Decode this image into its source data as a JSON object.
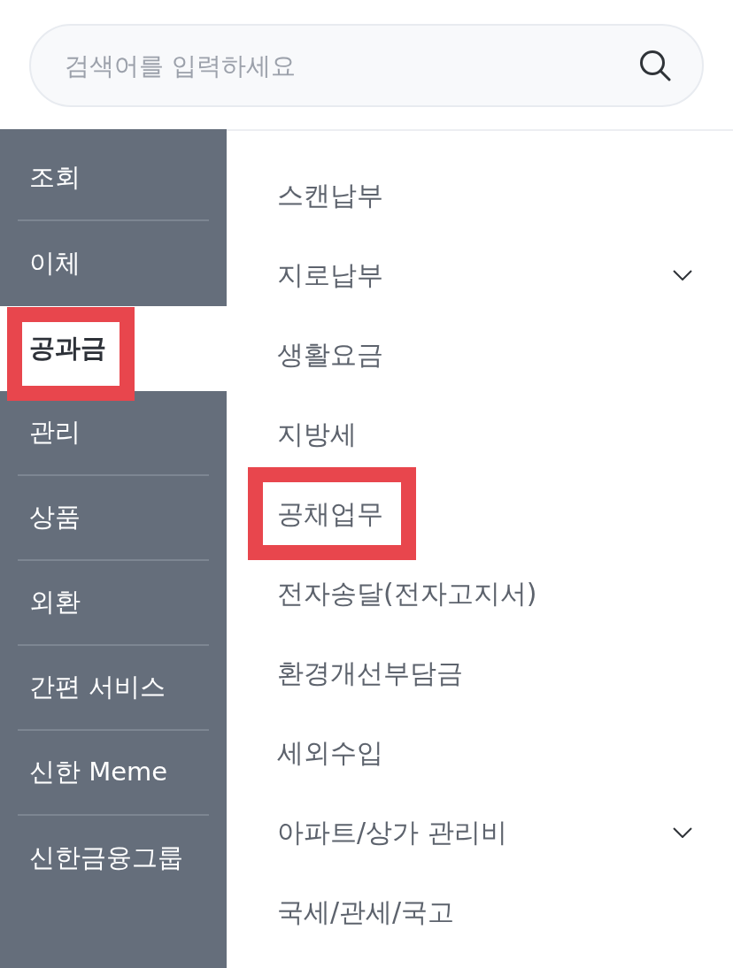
{
  "search": {
    "placeholder": "검색어를 입력하세요"
  },
  "sidebar": {
    "items": [
      {
        "label": "조회",
        "selected": false,
        "highlighted": false
      },
      {
        "label": "이체",
        "selected": false,
        "highlighted": false
      },
      {
        "label": "공과금",
        "selected": true,
        "highlighted": true
      },
      {
        "label": "관리",
        "selected": false,
        "highlighted": false
      },
      {
        "label": "상품",
        "selected": false,
        "highlighted": false
      },
      {
        "label": "외환",
        "selected": false,
        "highlighted": false
      },
      {
        "label": "간편 서비스",
        "selected": false,
        "highlighted": false
      },
      {
        "label": "신한 Meme",
        "selected": false,
        "highlighted": false
      },
      {
        "label": "신한금융그룹",
        "selected": false,
        "highlighted": false
      }
    ]
  },
  "submenu": {
    "items": [
      {
        "label": "스캔납부",
        "expandable": false,
        "highlighted": false
      },
      {
        "label": "지로납부",
        "expandable": true,
        "highlighted": false
      },
      {
        "label": "생활요금",
        "expandable": false,
        "highlighted": false
      },
      {
        "label": "지방세",
        "expandable": false,
        "highlighted": false
      },
      {
        "label": "공채업무",
        "expandable": false,
        "highlighted": true
      },
      {
        "label": "전자송달(전자고지서)",
        "expandable": false,
        "highlighted": false
      },
      {
        "label": "환경개선부담금",
        "expandable": false,
        "highlighted": false
      },
      {
        "label": "세외수입",
        "expandable": false,
        "highlighted": false
      },
      {
        "label": "아파트/상가 관리비",
        "expandable": true,
        "highlighted": false
      },
      {
        "label": "국세/관세/국고",
        "expandable": false,
        "highlighted": false
      }
    ]
  }
}
